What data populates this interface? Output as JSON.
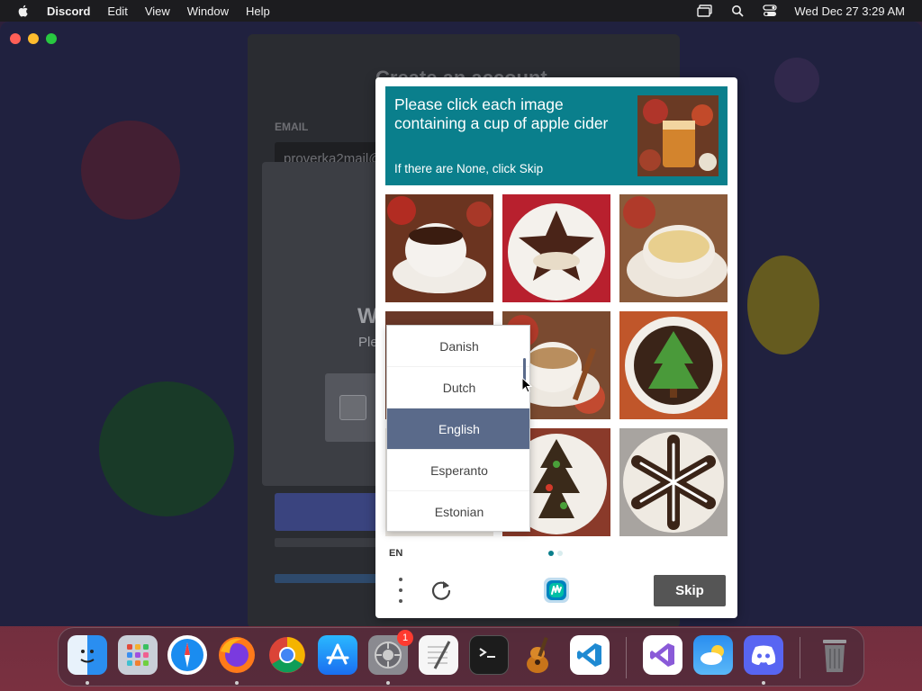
{
  "menubar": {
    "app_name": "Discord",
    "menus": [
      "Edit",
      "View",
      "Window",
      "Help"
    ],
    "clock": "Wed Dec 27  3:29 AM"
  },
  "discord": {
    "title": "Create an account",
    "email_label": "EMAIL",
    "email_value": "proverka2mail@",
    "modal_title": "W",
    "modal_sub": "Ple"
  },
  "captcha": {
    "prompt": "Please click each image containing a cup of apple cider",
    "hint": "If there are None, click Skip",
    "language_code": "EN",
    "skip_label": "Skip",
    "accent_color": "#0a7f8c",
    "languages": [
      {
        "label": "Danish",
        "selected": false
      },
      {
        "label": "Dutch",
        "selected": false
      },
      {
        "label": "English",
        "selected": true
      },
      {
        "label": "Esperanto",
        "selected": false
      },
      {
        "label": "Estonian",
        "selected": false
      }
    ],
    "tiles": [
      {
        "name": "tea-cup-with-apples",
        "icon": "cup"
      },
      {
        "name": "chocolate-star-cookie",
        "icon": "cookie"
      },
      {
        "name": "cup-of-cider-with-apple",
        "icon": "cup"
      },
      {
        "name": "hidden-tile",
        "icon": "hidden"
      },
      {
        "name": "coffee-with-cinnamon",
        "icon": "cup"
      },
      {
        "name": "christmas-tree-cookie",
        "icon": "cookie"
      },
      {
        "name": "hidden-tile",
        "icon": "hidden"
      },
      {
        "name": "tree-cookie",
        "icon": "cookie"
      },
      {
        "name": "snowflake-cookie",
        "icon": "cookie"
      }
    ]
  },
  "dock": {
    "settings_badge": "1",
    "apps": [
      "finder",
      "launchpad",
      "safari",
      "firefox",
      "chrome",
      "app-store",
      "system-settings",
      "textedit",
      "terminal",
      "garageband",
      "vscode",
      "visual-studio",
      "weather",
      "discord",
      "trash"
    ]
  }
}
